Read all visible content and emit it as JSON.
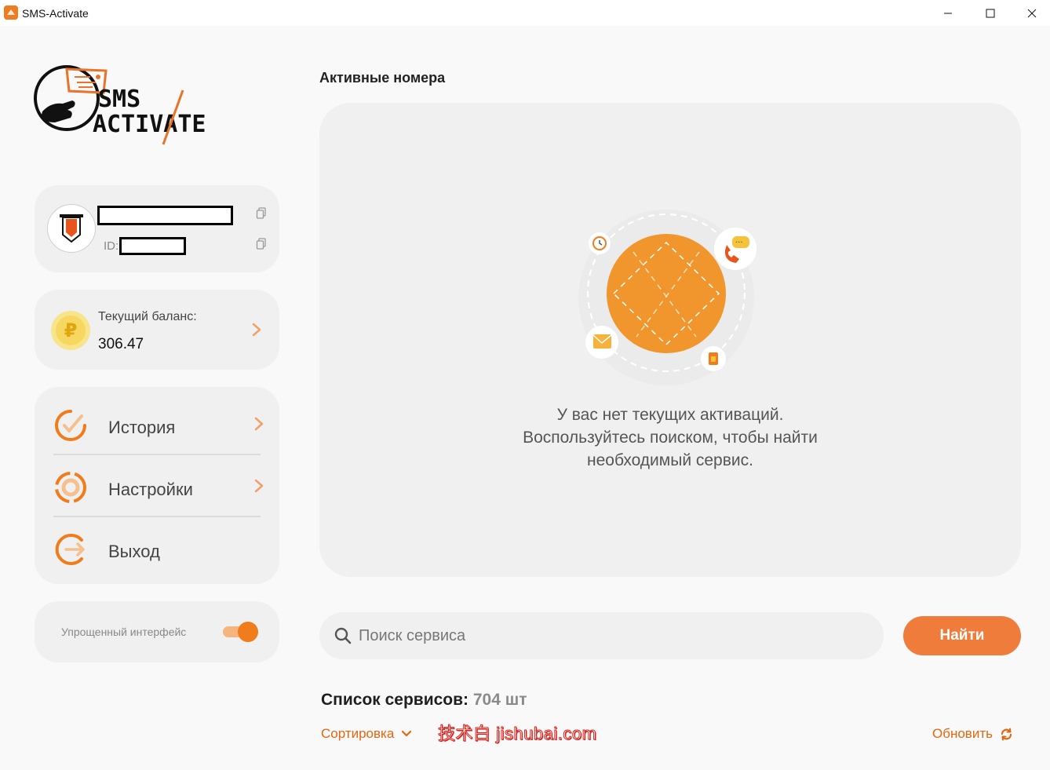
{
  "window": {
    "title": "SMS-Activate"
  },
  "logo": {
    "line1": "SMS",
    "line2": "ACTIVATE"
  },
  "profile": {
    "id_label": "ID:"
  },
  "balance": {
    "label": "Текущий баланс:",
    "value": "306.47",
    "currency_symbol": "₽"
  },
  "menu": {
    "items": [
      {
        "label": "История",
        "icon": "history-icon"
      },
      {
        "label": "Настройки",
        "icon": "settings-icon"
      },
      {
        "label": "Выход",
        "icon": "logout-icon"
      }
    ]
  },
  "simple_interface": {
    "label": "Упрощенный интерфейс",
    "enabled": true
  },
  "active_numbers": {
    "title": "Активные номера",
    "empty_line1": "У вас нет текущих активаций.",
    "empty_line2": "Воспользуйтесь поиском, чтобы найти",
    "empty_line3": "необходимый сервис."
  },
  "search": {
    "placeholder": "Поиск сервиса",
    "button_label": "Найти"
  },
  "services": {
    "title": "Список сервисов:",
    "count": "704 шт",
    "sort_label": "Сортировка",
    "refresh_label": "Обновить"
  },
  "watermark": "技术白 jishubai.com",
  "colors": {
    "accent": "#ef7c3b",
    "orange_text": "#e0680f",
    "panel": "#f0f0f0"
  }
}
